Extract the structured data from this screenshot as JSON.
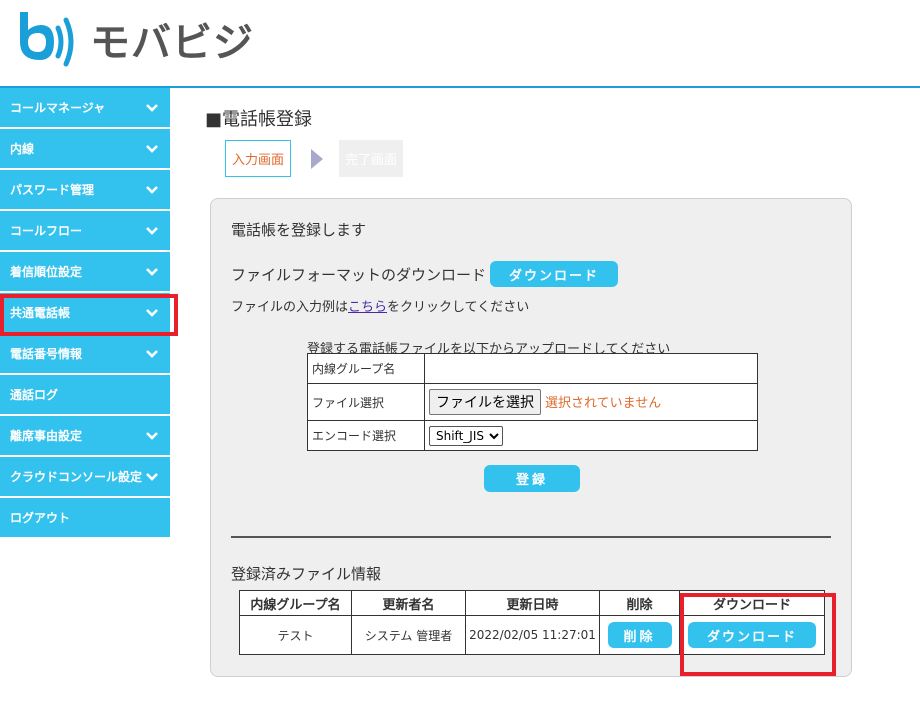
{
  "brand": {
    "name": "モバビジ",
    "accent": "#1a9fd8",
    "nav_color": "#33c1ee",
    "highlight_color": "#e8202c"
  },
  "sidebar": {
    "items": [
      {
        "label": "コールマネージャ",
        "has_chevron": true
      },
      {
        "label": "内線",
        "has_chevron": true
      },
      {
        "label": "パスワード管理",
        "has_chevron": true
      },
      {
        "label": "コールフロー",
        "has_chevron": true
      },
      {
        "label": "着信順位設定",
        "has_chevron": true
      },
      {
        "label": "共通電話帳",
        "has_chevron": true
      },
      {
        "label": "電話番号情報",
        "has_chevron": true
      },
      {
        "label": "通話ログ",
        "has_chevron": false
      },
      {
        "label": "離席事由設定",
        "has_chevron": true
      },
      {
        "label": "クラウドコンソール設定",
        "has_chevron": true
      },
      {
        "label": "ログアウト",
        "has_chevron": false
      }
    ]
  },
  "main": {
    "title": "■電話帳登録",
    "steps": {
      "current": "入力画面",
      "next": "完了画面"
    },
    "panel": {
      "heading": "電話帳を登録します",
      "format_label": "ファイルフォーマットのダウンロード",
      "format_button": "ダウンロード",
      "example_prefix": "ファイルの入力例は",
      "example_link": "こちら",
      "example_suffix": "をクリックしてください",
      "upload_caption": "登録する電話帳ファイルを以下からアップロードしてください",
      "form": {
        "group_label": "内線グループ名",
        "group_value": "",
        "file_label": "ファイル選択",
        "file_button": "ファイルを選択",
        "file_status": "選択されていません",
        "encode_label": "エンコード選択",
        "encode_value": "Shift_JIS"
      },
      "register_button": "登録",
      "files_heading": "登録済みファイル情報",
      "files_table": {
        "headers": [
          "内線グループ名",
          "更新者名",
          "更新日時",
          "削除",
          "ダウンロード"
        ],
        "rows": [
          {
            "group": "テスト",
            "updater": "システム 管理者",
            "updated": "2022/02/05 11:27:01",
            "delete": "削除",
            "download": "ダウンロード"
          }
        ]
      }
    }
  }
}
